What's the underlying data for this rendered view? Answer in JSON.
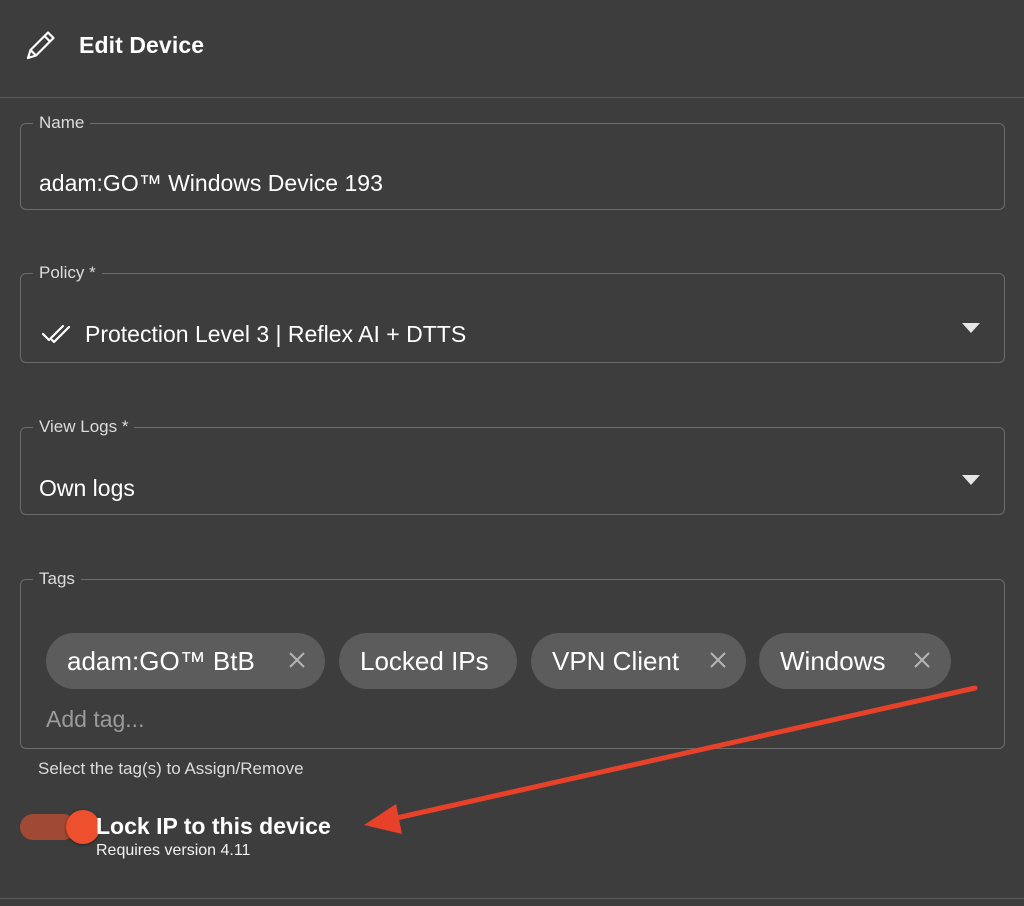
{
  "header": {
    "title": "Edit Device",
    "icon": "pencil-icon"
  },
  "form": {
    "name": {
      "label": "Name",
      "value": "adam:GO™ Windows Device 193"
    },
    "policy": {
      "label": "Policy *",
      "value": "Protection Level 3 | Reflex AI + DTTS",
      "icon": "double-check-icon"
    },
    "view_logs": {
      "label": "View Logs *",
      "value": "Own logs"
    },
    "tags": {
      "label": "Tags",
      "chips": [
        {
          "label": "adam:GO™ BtB",
          "removable": true
        },
        {
          "label": "Locked IPs",
          "removable": false
        },
        {
          "label": "VPN Client",
          "removable": true
        },
        {
          "label": "Windows",
          "removable": true
        }
      ],
      "placeholder": "Add tag...",
      "helper": "Select the tag(s) to Assign/Remove"
    },
    "lock_ip": {
      "label": "Lock IP to this device",
      "sublabel": "Requires version 4.11",
      "enabled": true
    }
  },
  "colors": {
    "background": "#3d3d3d",
    "accent": "#ee4f2d",
    "chip": "#5c5c5c",
    "annotation_arrow": "#e8412a"
  }
}
